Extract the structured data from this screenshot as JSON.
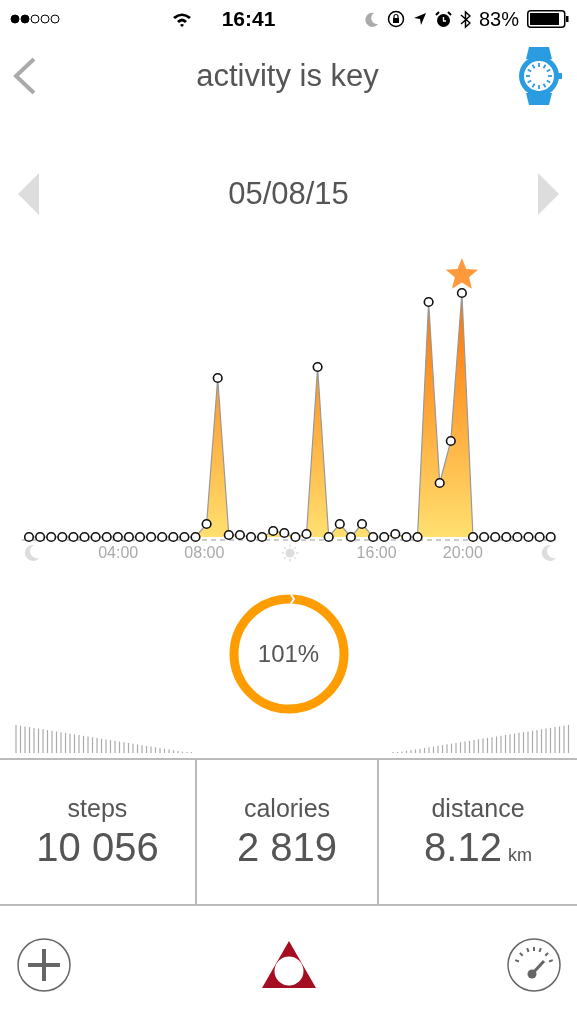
{
  "status_bar": {
    "time": "16:41",
    "battery": "83%"
  },
  "header": {
    "title": "activity is key"
  },
  "date_nav": {
    "date": "05/08/15"
  },
  "chart": {
    "x_labels": [
      {
        "kind": "moon"
      },
      {
        "kind": "text",
        "text": "04:00"
      },
      {
        "kind": "text",
        "text": "08:00"
      },
      {
        "kind": "sun"
      },
      {
        "kind": "text",
        "text": "16:00"
      },
      {
        "kind": "text",
        "text": "20:00"
      },
      {
        "kind": "moon"
      }
    ]
  },
  "goal": {
    "percent": "101%"
  },
  "stats": [
    {
      "label": "steps",
      "value": "10 056"
    },
    {
      "label": "calories",
      "value": "2 819"
    },
    {
      "label": "distance",
      "value": "8.12",
      "unit": "km"
    }
  ]
}
